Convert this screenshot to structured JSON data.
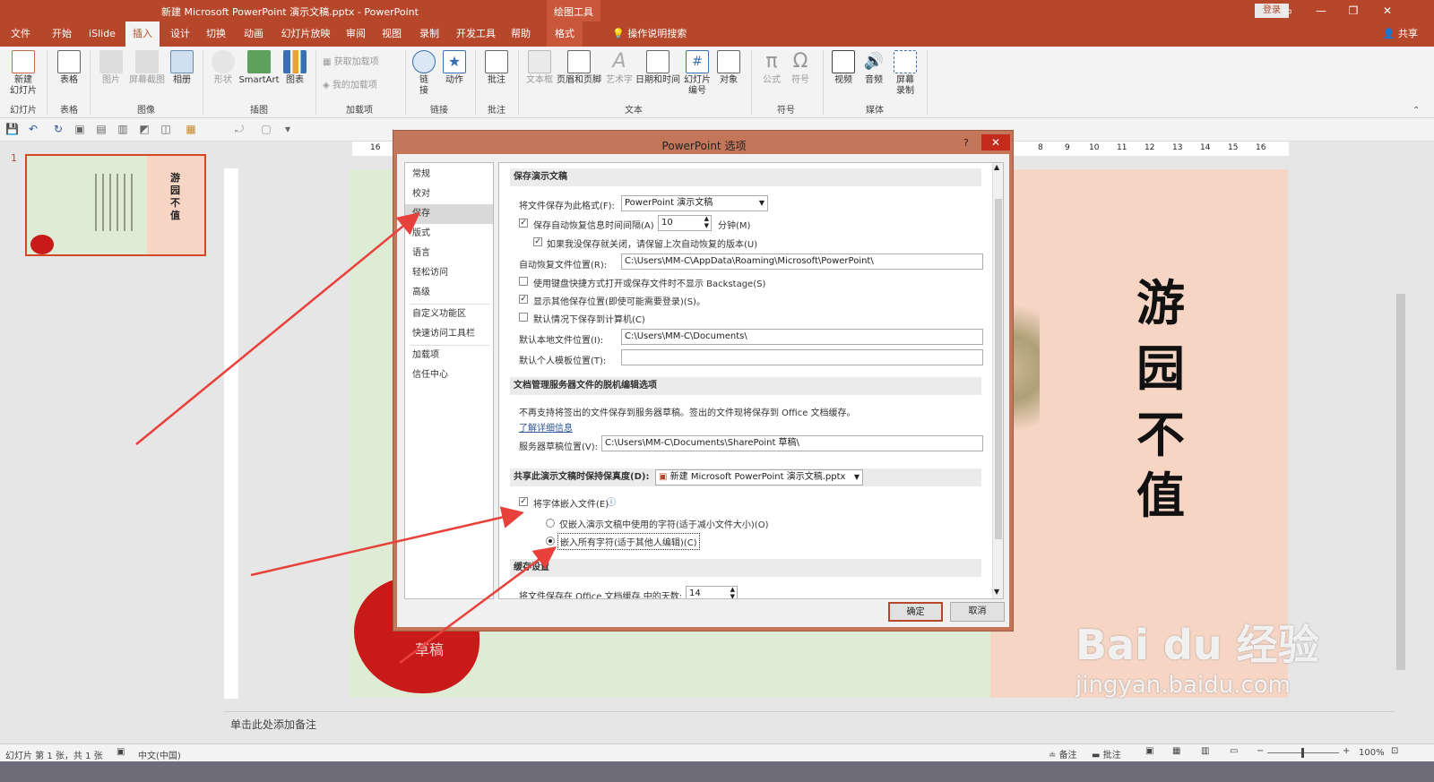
{
  "window": {
    "title": "新建 Microsoft PowerPoint 演示文稿.pptx  -  PowerPoint",
    "context_tab_group": "绘图工具",
    "login": "登录",
    "share": "共享"
  },
  "tabs": [
    "文件",
    "开始",
    "iSlide",
    "插入",
    "设计",
    "切换",
    "动画",
    "幻灯片放映",
    "审阅",
    "视图",
    "录制",
    "开发工具",
    "帮助",
    "格式"
  ],
  "active_tab": "插入",
  "tell_me": "操作说明搜索",
  "ribbon": {
    "buttons": {
      "new_slide": "新建\n幻灯片",
      "table": "表格",
      "picture": "图片",
      "screenshot": "屏幕截图",
      "album": "相册",
      "shapes": "形状",
      "smartart": "SmartArt",
      "chart": "图表",
      "get_addins": "获取加载项",
      "my_addins": "我的加载项",
      "link": "链\n接",
      "action": "动作",
      "comment": "批注",
      "textbox": "文本框",
      "header_footer": "页眉和页脚",
      "wordart": "艺术字",
      "datetime": "日期和时间",
      "slide_number": "幻灯片\n编号",
      "object": "对象",
      "equation": "公式",
      "symbol": "符号",
      "video": "视频",
      "audio": "音频",
      "screen_record": "屏幕\n录制"
    },
    "groups": {
      "slides": "幻灯片",
      "tables": "表格",
      "images": "图像",
      "illustrations": "插图",
      "addins": "加载项",
      "links": "链接",
      "comments": "批注",
      "text": "文本",
      "symbols": "符号",
      "media": "媒体"
    }
  },
  "thumbnail": {
    "number": "1"
  },
  "slide": {
    "title_chars": [
      "游",
      "园",
      "不",
      "值"
    ],
    "seal_text": "草稿"
  },
  "notes_placeholder": "单击此处添加备注",
  "status": {
    "slide_info": "幻灯片 第 1 张，共 1 张",
    "language": "中文(中国)",
    "notes": "备注",
    "comments": "批注",
    "zoom": "100%"
  },
  "ruler_h": [
    "16",
    "8",
    "9",
    "10",
    "11",
    "12",
    "13",
    "14",
    "15",
    "16"
  ],
  "dialog": {
    "title": "PowerPoint 选项",
    "help": "?",
    "nav": [
      "常规",
      "校对",
      "保存",
      "版式",
      "语言",
      "轻松访问",
      "高级",
      "自定义功能区",
      "快速访问工具栏",
      "加载项",
      "信任中心"
    ],
    "nav_selected": "保存",
    "save_section": "保存演示文稿",
    "save_format_label": "将文件保存为此格式(F):",
    "save_format_value": "PowerPoint 演示文稿",
    "autorecover_label": "保存自动恢复信息时间间隔(A)",
    "autorecover_minutes": "10",
    "minutes_label": "分钟(M)",
    "keep_last_label": "如果我没保存就关闭，请保留上次自动恢复的版本(U)",
    "autorecover_loc_label": "自动恢复文件位置(R):",
    "autorecover_loc_value": "C:\\Users\\MM-C\\AppData\\Roaming\\Microsoft\\PowerPoint\\",
    "no_backstage_label": "使用键盘快捷方式打开或保存文件时不显示 Backstage(S)",
    "show_more_locations_label": "显示其他保存位置(即使可能需要登录)(S)。",
    "save_to_computer_label": "默认情况下保存到计算机(C)",
    "default_local_label": "默认本地文件位置(I):",
    "default_local_value": "C:\\Users\\MM-C\\Documents\\",
    "default_template_label": "默认个人模板位置(T):",
    "default_template_value": "",
    "offline_section": "文档管理服务器文件的脱机编辑选项",
    "offline_note": "不再支持将签出的文件保存到服务器草稿。签出的文件现将保存到 Office 文档缓存。",
    "learn_more": "了解详细信息",
    "server_drafts_label": "服务器草稿位置(V):",
    "server_drafts_value": "C:\\Users\\MM-C\\Documents\\SharePoint 草稿\\",
    "fidelity_label": "共享此演示文稿时保持保真度(D):",
    "fidelity_file": "新建 Microsoft PowerPoint 演示文稿.pptx",
    "embed_fonts_label": "将字体嵌入文件(E)",
    "embed_used_label": "仅嵌入演示文稿中使用的字符(适于减小文件大小)(O)",
    "embed_all_label": "嵌入所有字符(适于其他人编辑)(C)",
    "cache_section": "缓存设置",
    "cache_days_label": "将文件保存在 Office 文档缓存 中的天数:",
    "cache_days_value": "14",
    "ok": "确定",
    "cancel": "取消"
  },
  "watermark": {
    "brand": "Bai du 经验",
    "url": "jingyan.baidu.com"
  },
  "colors": {
    "accent": "#b7472a",
    "arrow": "#e8413b",
    "slide_green": "#dfecd5",
    "slide_peach": "#f6d5c4",
    "seal": "#c91a1a"
  }
}
